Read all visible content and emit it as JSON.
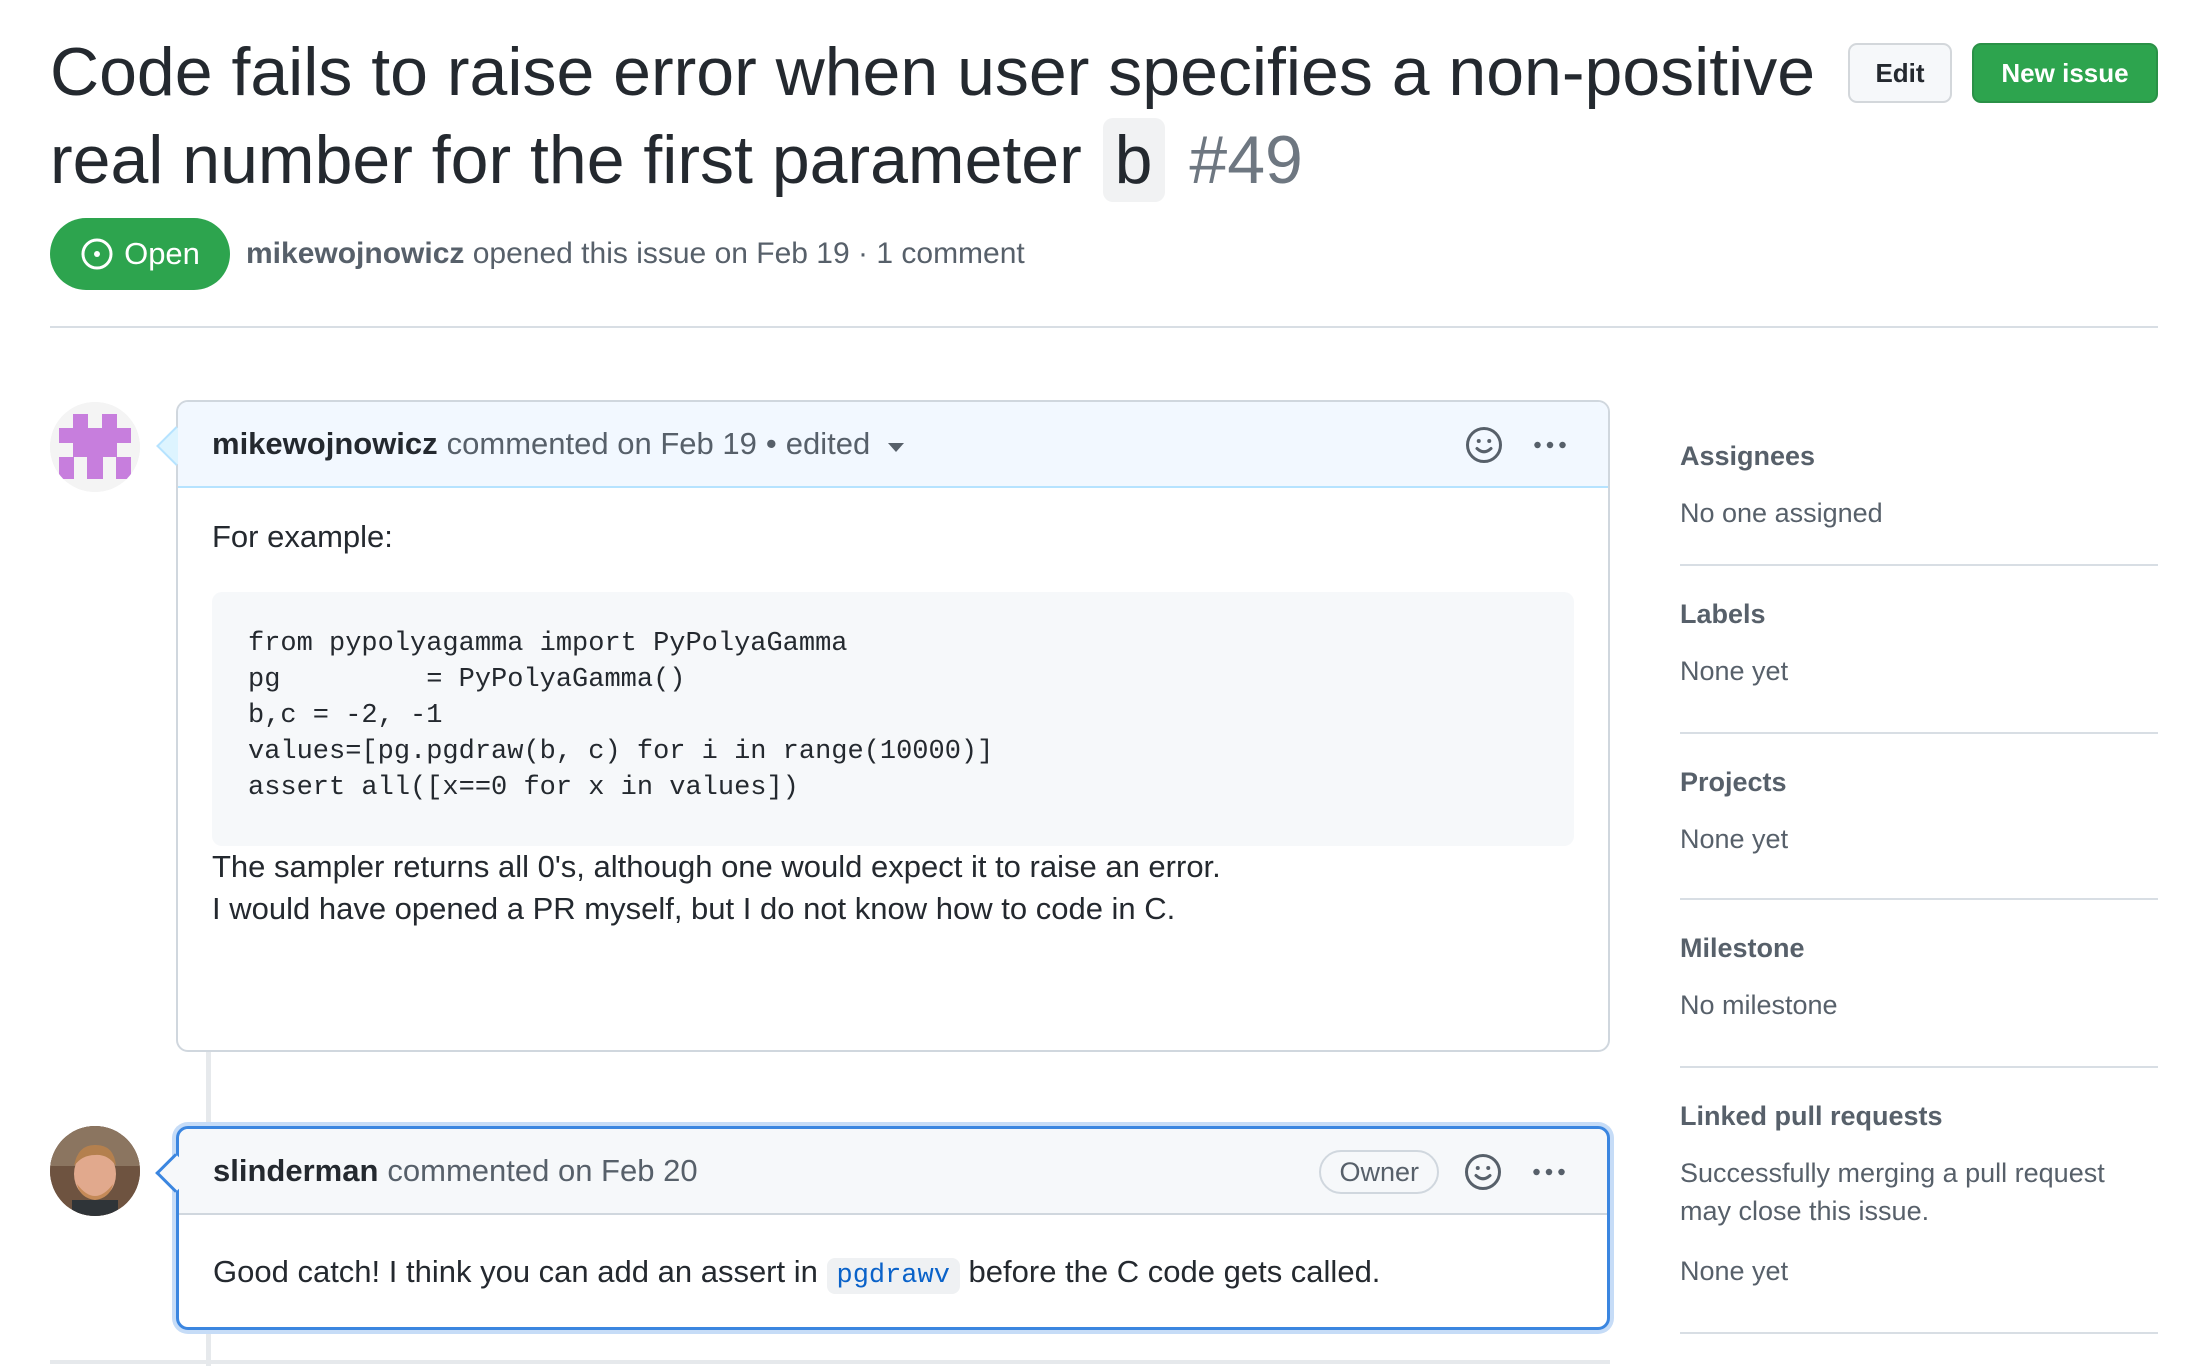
{
  "issue": {
    "title_prefix": "Code fails to raise error when user specifies a non-positive real number for the first parameter",
    "title_code": "b",
    "number": "#49",
    "state": "Open",
    "author": "mikewojnowicz",
    "opened_text": "opened this issue on Feb 19",
    "separator": "·",
    "comment_count": "1 comment"
  },
  "header_buttons": {
    "edit": "Edit",
    "new_issue": "New issue"
  },
  "comments": [
    {
      "author": "mikewojnowicz",
      "action": "commented on Feb 19",
      "dot": "•",
      "edited": "edited",
      "intro": "For example:",
      "code": "from pypolyagamma import PyPolyaGamma\npg         = PyPolyaGamma()\nb,c = -2, -1\nvalues=[pg.pgdraw(b, c) for i in range(10000)]\nassert all([x==0 for x in values])",
      "para1": "The sampler returns all 0's, although one would expect it to raise an error.",
      "para2": "I would have opened a PR myself, but I do not know how to code in C."
    },
    {
      "author": "slinderman",
      "action": "commented on Feb 20",
      "badge": "Owner",
      "text_before": "Good catch! I think you can add an assert in",
      "inline_code": "pgdrawv",
      "text_after": "before the C code gets called."
    }
  ],
  "sidebar": {
    "assignees": {
      "heading": "Assignees",
      "value": "No one assigned"
    },
    "labels": {
      "heading": "Labels",
      "value": "None yet"
    },
    "projects": {
      "heading": "Projects",
      "value": "None yet"
    },
    "milestone": {
      "heading": "Milestone",
      "value": "No milestone"
    },
    "linked_prs": {
      "heading": "Linked pull requests",
      "description": "Successfully merging a pull request may close this issue.",
      "value": "None yet"
    }
  },
  "colors": {
    "open_green": "#2da44e",
    "link_blue": "#0a62c9",
    "focus_blue": "#3b86e0",
    "identicon_purple": "#c77edd"
  },
  "icons": {
    "state": "issue-opened-icon",
    "reaction": "smiley-icon",
    "menu": "kebab-horizontal-icon",
    "edit_history": "triangle-down-icon"
  }
}
